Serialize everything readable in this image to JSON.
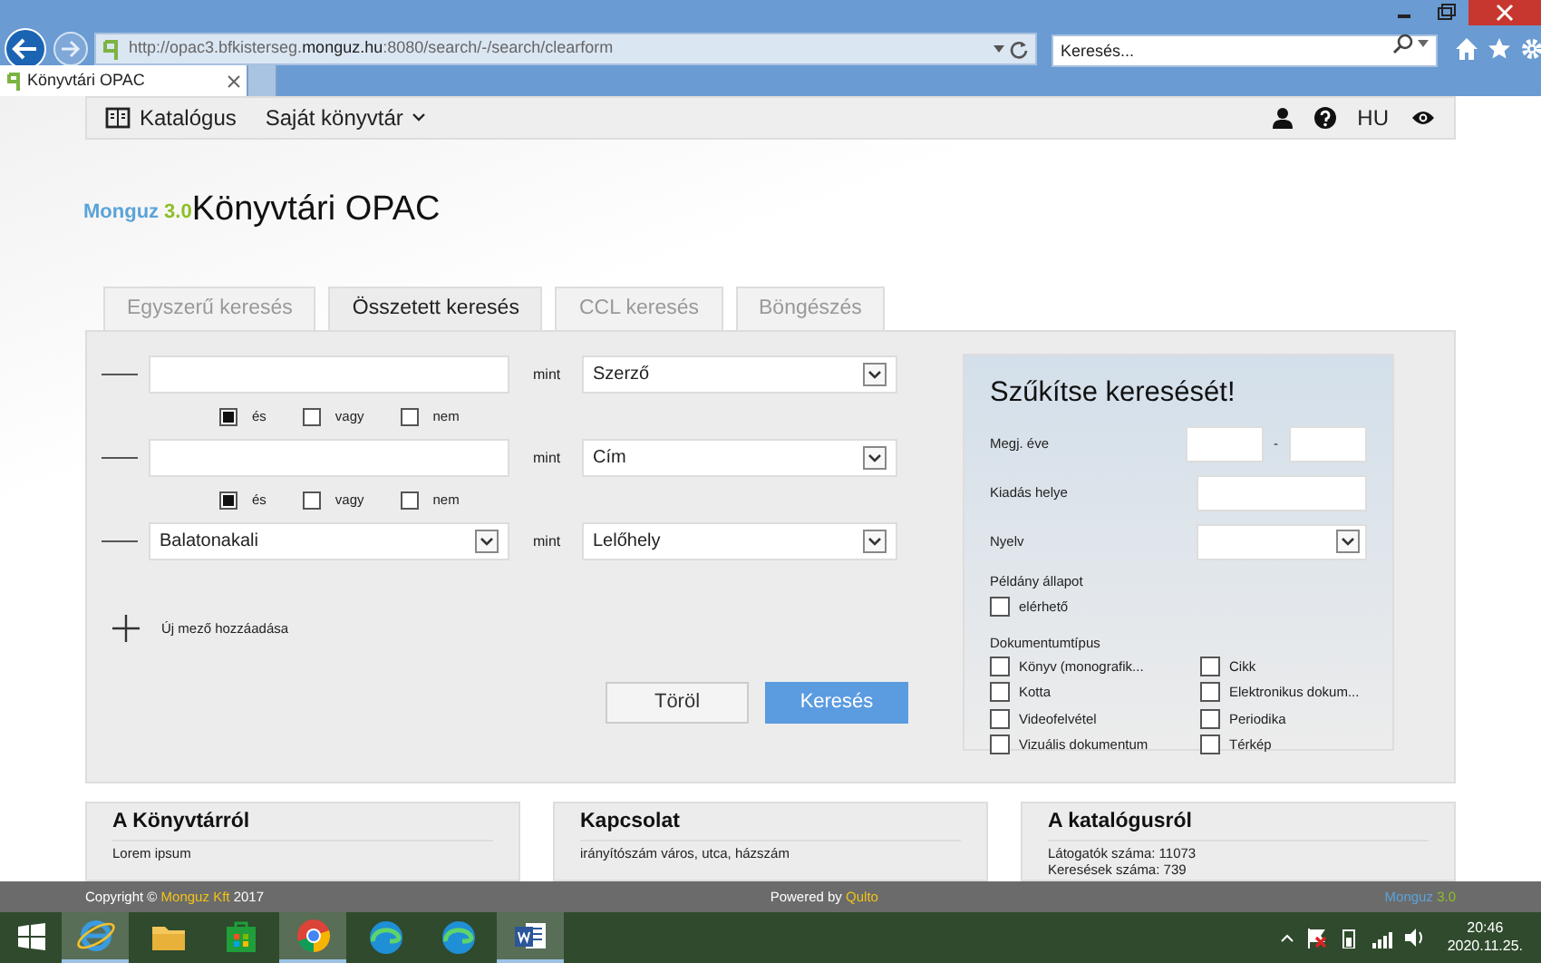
{
  "browser": {
    "url_prefix": "http://opac3.bfkisterseg.",
    "url_domain": "monguz.hu",
    "url_suffix": ":8080/search/-/search/clearform",
    "search_placeholder": "Keresés...",
    "tabs": [
      {
        "label": "Könyvtári OPAC",
        "selected": true
      },
      {
        "selected": false
      }
    ]
  },
  "nav": {
    "items": [
      {
        "label": "Katalógus",
        "kind": "book"
      },
      {
        "label": "Saját könyvtár",
        "kind": "dropdown"
      }
    ],
    "lang": "HU"
  },
  "logo": {
    "brand": "Monguz",
    "version": "3.0",
    "title": "Könyvtári OPAC"
  },
  "search_tabs": [
    {
      "label": "Egyszerű keresés",
      "selected": false
    },
    {
      "label": "Összetett keresés",
      "selected": true
    },
    {
      "label": "CCL keresés",
      "selected": false
    },
    {
      "label": "Böngészés",
      "selected": false
    }
  ],
  "fields": [
    {
      "kind": "text",
      "connector": "mint",
      "field": "Szerző",
      "operators": [
        {
          "label": "és",
          "checked": true
        },
        {
          "label": "vagy",
          "checked": false
        },
        {
          "label": "nem",
          "checked": false
        }
      ]
    },
    {
      "kind": "text",
      "connector": "mint",
      "field": "Cím",
      "operators": [
        {
          "label": "és",
          "checked": true
        },
        {
          "label": "vagy",
          "checked": false
        },
        {
          "label": "nem",
          "checked": false
        }
      ]
    },
    {
      "kind": "select",
      "value": "Balatonakali",
      "connector": "mint",
      "field": "Lelőhely"
    }
  ],
  "add_field": "Új mező hozzáadása",
  "buttons": [
    {
      "label": "Töröl",
      "kind": "secondary"
    },
    {
      "label": "Keresés",
      "kind": "primary"
    }
  ],
  "narrow": {
    "title": "Szűkítse keresését!",
    "year_label": "Megj. éve",
    "year_sep": "-",
    "place_label": "Kiadás helye",
    "lang_label": "Nyelv",
    "status_label": "Példány állapot",
    "status": [
      {
        "label": "elérhető",
        "checked": false
      }
    ],
    "doctype_label": "Dokumentumtípus",
    "doctypes": [
      {
        "label": "Könyv (monografik...",
        "checked": false
      },
      {
        "label": "Cikk",
        "checked": false
      },
      {
        "label": "Kotta",
        "checked": false
      },
      {
        "label": "Elektronikus dokum...",
        "checked": false
      },
      {
        "label": "Videofelvétel",
        "checked": false
      },
      {
        "label": "Periodika",
        "checked": false
      },
      {
        "label": "Vizuális dokumentum",
        "checked": false
      },
      {
        "label": "Térkép",
        "checked": false
      }
    ]
  },
  "cards": [
    {
      "title": "A Könyvtárról",
      "lines": [
        "Lorem ipsum"
      ]
    },
    {
      "title": "Kapcsolat",
      "lines": [
        "irányítószám város, utca, házszám"
      ]
    },
    {
      "title": "A katalógusról",
      "lines": [
        "Látogatók száma: 11073",
        "Keresések száma: 739"
      ]
    }
  ],
  "footer": {
    "copyright": "Copyright ©",
    "company": "Monguz Kft",
    "year": "2017",
    "powered": "Powered by",
    "powered_name": "Qulto",
    "brand": "Monguz",
    "version": "3.0"
  },
  "taskbar": {
    "apps": [
      {
        "kind": "ie",
        "active": true
      },
      {
        "kind": "folder",
        "active": false
      },
      {
        "kind": "store",
        "active": false
      },
      {
        "kind": "chrome",
        "active": true
      },
      {
        "kind": "edge",
        "active": false
      },
      {
        "kind": "edge",
        "active": false
      },
      {
        "kind": "word",
        "active": true
      }
    ],
    "time": "20:46",
    "date": "2020.11.25."
  }
}
